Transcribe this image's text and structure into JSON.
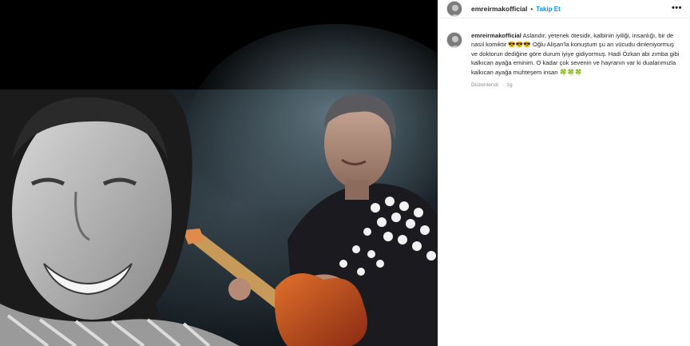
{
  "post": {
    "username": "emreirmakofficial",
    "separator": "•",
    "follow_label": "Takip Et",
    "more_label": "•••",
    "caption": {
      "username": "emreirmakofficial",
      "text": "Aslandır, yetenek ötesidir, kalbinin iyiliği, insanlığı, bir de nasıl komiktir 😎😎😎 Oğlu Alişan'la konuştum şu an vücudu dinleniyormuş ve doktorun dediğine göre durum iyiye gidiyormuş. Hadi Özkan abi zımba gibi kalkıcan ayağa eminim. O kadar çok sevenin ve hayranın var ki dualarımızla kalkıcan ayağa muhteşem insan 🍀🍀🍀",
      "edited_label": "Düzenlendi",
      "separator": "·",
      "time": "1g"
    }
  },
  "icons": [
    "avatar",
    "more-options-icon"
  ],
  "colors": {
    "link_blue": "#0095f6",
    "muted": "#8e8e8e",
    "text": "#262626"
  }
}
